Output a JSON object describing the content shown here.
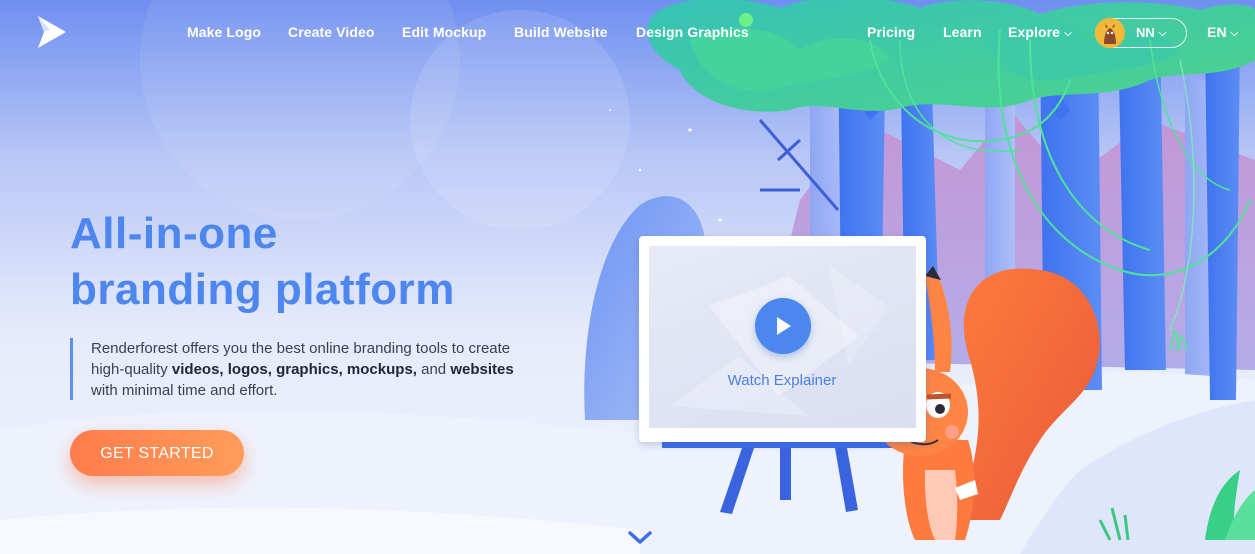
{
  "nav": {
    "links_left": [
      "Make Logo",
      "Create Video",
      "Edit Mockup",
      "Build Website",
      "Design Graphics"
    ],
    "pricing": "Pricing",
    "learn": "Learn",
    "explore": "Explore",
    "user_initials": "NN",
    "language": "EN"
  },
  "hero": {
    "title_line1": "All-in-one",
    "title_line2": "branding platform",
    "desc_part1": "Renderforest offers you the best online branding tools to create high-quality ",
    "desc_bold1": "videos, logos, graphics, mockups,",
    "desc_part2": " and ",
    "desc_bold2": "websites",
    "desc_part3": " with minimal time and effort.",
    "cta": "GET STARTED"
  },
  "video": {
    "watch_label": "Watch Explainer"
  },
  "icons": {
    "logo": "renderforest-play-logo-icon",
    "dropdown": "chevron-down-icon",
    "play": "play-icon",
    "scroll": "scroll-down-chevron-icon"
  },
  "colors": {
    "accent_blue": "#4d86ef",
    "cta_orange": "#ff8451",
    "text_dark": "#222637",
    "nav_text": "#ffffff"
  }
}
